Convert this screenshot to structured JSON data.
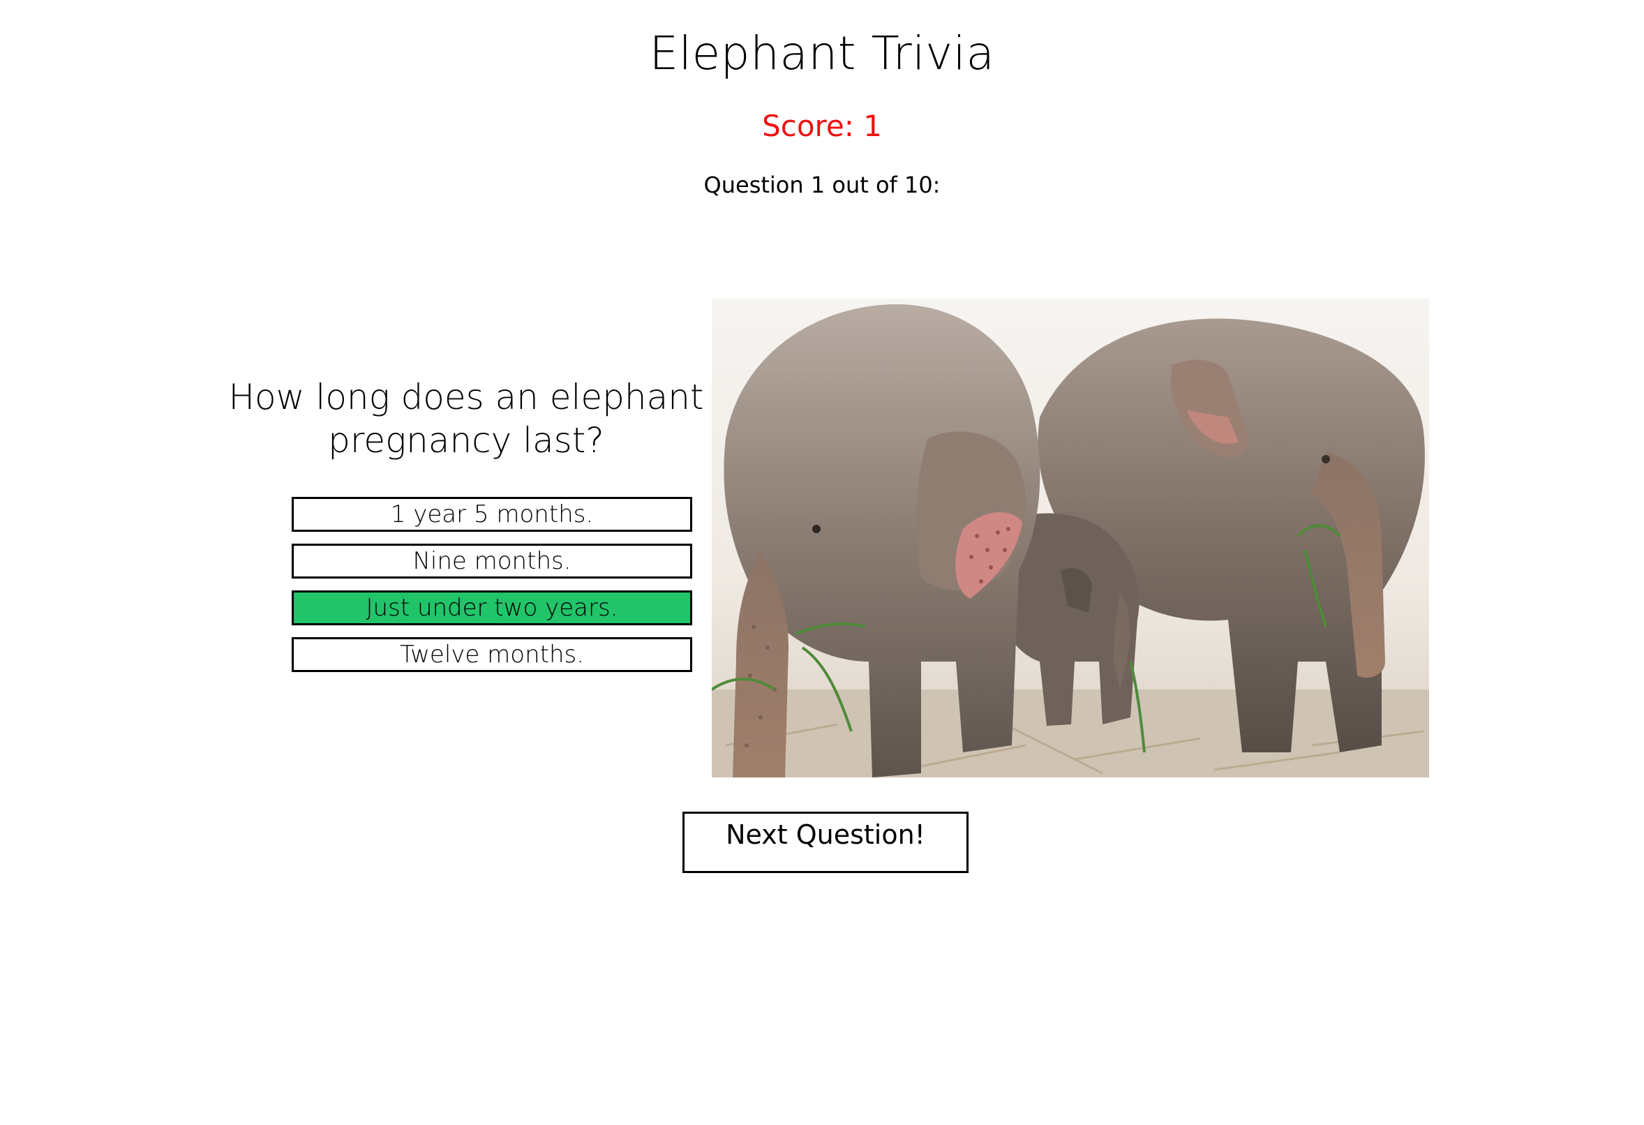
{
  "header": {
    "title": "Elephant Trivia",
    "score_label": "Score: 1",
    "question_counter": "Question 1 out of 10:"
  },
  "quiz": {
    "question": "How long does an elephant pregnancy last?",
    "answers": [
      {
        "label": "1 year 5 months.",
        "state": "default"
      },
      {
        "label": "Nine months.",
        "state": "default"
      },
      {
        "label": "Just under two years.",
        "state": "correct"
      },
      {
        "label": "Twelve months."
      }
    ],
    "correct_color": "#22c46a",
    "score_color": "#ee1111"
  },
  "photo": {
    "subject": "elephant-family-photo"
  },
  "footer": {
    "next_label": "Next Question!"
  }
}
